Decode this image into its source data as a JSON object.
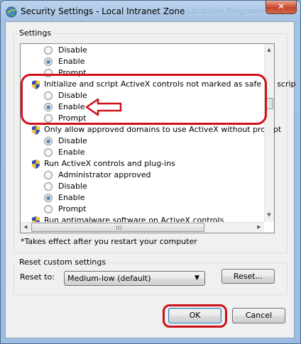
{
  "window": {
    "title": "Security Settings - Local Intranet Zone",
    "background_text": "...Locations   Programs   Adv...",
    "close_glyph": "✕"
  },
  "settings_group": {
    "label": "Settings",
    "rows": [
      {
        "type": "radio",
        "label": "Disable",
        "checked": false
      },
      {
        "type": "radio",
        "label": "Enable",
        "checked": true
      },
      {
        "type": "radio",
        "label": "Prompt",
        "checked": false
      },
      {
        "type": "category",
        "label": "Initialize and script ActiveX controls not marked as safe for scrip"
      },
      {
        "type": "radio",
        "label": "Disable",
        "checked": false
      },
      {
        "type": "radio",
        "label": "Enable",
        "checked": true
      },
      {
        "type": "radio",
        "label": "Prompt",
        "checked": false
      },
      {
        "type": "category",
        "label": "Only allow approved domains to use ActiveX without prompt"
      },
      {
        "type": "radio",
        "label": "Disable",
        "checked": true
      },
      {
        "type": "radio",
        "label": "Enable",
        "checked": false
      },
      {
        "type": "category",
        "label": "Run ActiveX controls and plug-ins"
      },
      {
        "type": "radio",
        "label": "Administrator approved",
        "checked": false
      },
      {
        "type": "radio",
        "label": "Disable",
        "checked": false
      },
      {
        "type": "radio",
        "label": "Enable",
        "checked": true
      },
      {
        "type": "radio",
        "label": "Prompt",
        "checked": false
      },
      {
        "type": "category",
        "label": "Run antimalware software on ActiveX controls"
      }
    ],
    "note": "*Takes effect after you restart your computer"
  },
  "reset_group": {
    "label": "Reset custom settings",
    "reset_to_label": "Reset to:",
    "selected_level": "Medium-low (default)",
    "reset_button": "Reset..."
  },
  "footer": {
    "ok": "OK",
    "cancel": "Cancel"
  },
  "annotations": {
    "color": "#d0101a",
    "marks": [
      "ellipse-around-initialize-activex-setting",
      "arrow-pointing-at-enable",
      "ellipse-around-ok-button"
    ]
  },
  "colors": {
    "titlebar": "#a5c2e3",
    "client_background": "#f0f0f0",
    "default_button_border": "#3c7fb1"
  }
}
